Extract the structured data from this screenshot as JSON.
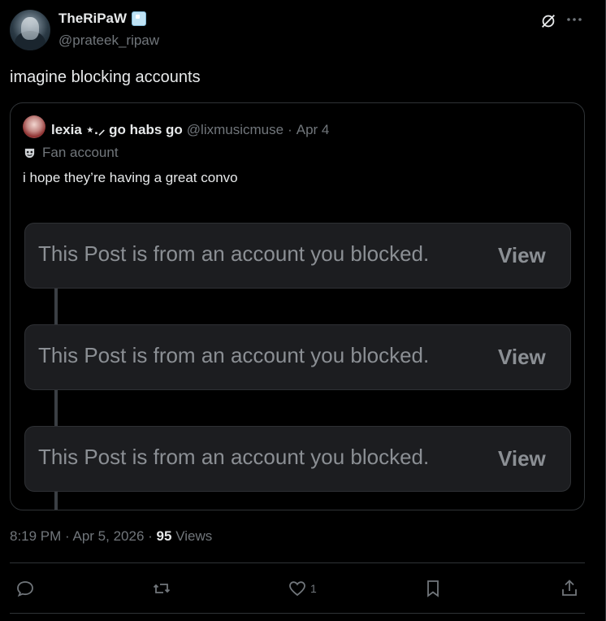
{
  "author": {
    "display_name": "TheRiPaW",
    "handle": "@prateek_ripaw",
    "badge_icon": "ice-cube-icon"
  },
  "post": {
    "text": "imagine blocking accounts",
    "time": "8:19 PM",
    "date": "Apr 5, 2026",
    "views_count": "95",
    "views_label": "Views"
  },
  "quote": {
    "display_name": "lexia ⋆.⸝ go habs go",
    "handle": "@lixmusicmuse",
    "date": "Apr 4",
    "fan_label": "Fan account",
    "text": "i hope they’re having a great convo",
    "blocked_posts": [
      {
        "text": "This Post is from an account you blocked.",
        "action": "View"
      },
      {
        "text": "This Post is from an account you blocked.",
        "action": "View"
      },
      {
        "text": "This Post is from an account you blocked.",
        "action": "View"
      }
    ]
  },
  "actions": {
    "reply_count": "",
    "repost_count": "",
    "like_count": "1",
    "bookmark_count": ""
  },
  "colors": {
    "background": "#000000",
    "primary_text": "#e7e9ea",
    "secondary_text": "#71767b",
    "border": "#2f3336",
    "blocked_box": "#1c1d20"
  }
}
